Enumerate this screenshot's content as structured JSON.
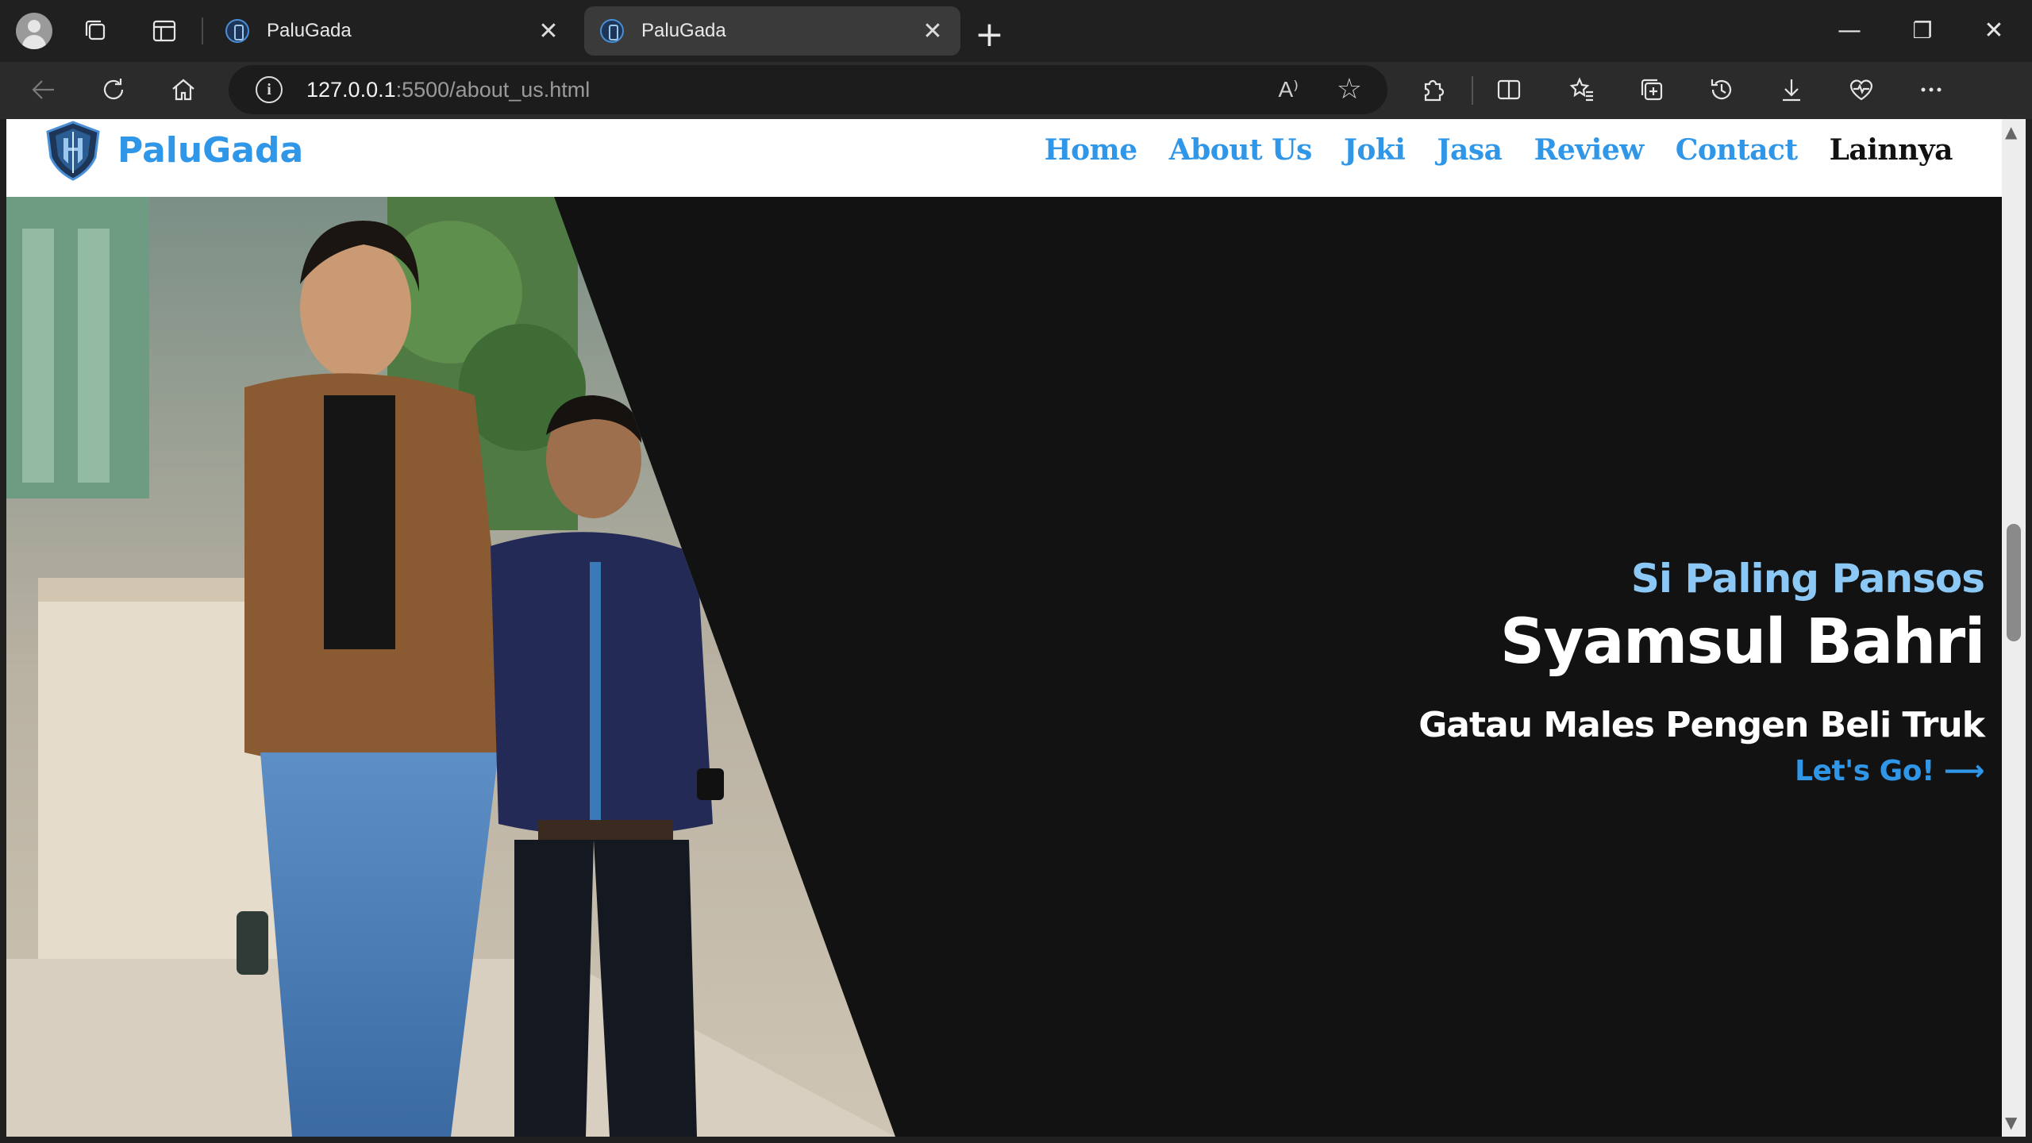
{
  "browser": {
    "tabs": [
      {
        "title": "PaluGada",
        "active": false
      },
      {
        "title": "PaluGada",
        "active": true
      }
    ],
    "url_host": "127.0.0.1",
    "url_rest": ":5500/about_us.html",
    "window_controls": {
      "minimize": "—",
      "restore": "❐",
      "close": "✕"
    },
    "tab_close_glyph": "✕",
    "new_tab_glyph": "+",
    "read_aloud_glyph": "A⁾",
    "info_glyph": "i",
    "star_glyph": "☆"
  },
  "site": {
    "brand": "PaluGada",
    "nav": [
      {
        "label": "Home",
        "active": true
      },
      {
        "label": "About Us",
        "active": true
      },
      {
        "label": "Joki",
        "active": true
      },
      {
        "label": "Jasa",
        "active": true
      },
      {
        "label": "Review",
        "active": true
      },
      {
        "label": "Contact",
        "active": true
      },
      {
        "label": "Lainnya",
        "active": false
      }
    ]
  },
  "hero": {
    "subtitle": "Si Paling Pansos",
    "name": "Syamsul Bahri",
    "tagline": "Gatau Males Pengen Beli Truk",
    "cta": "Let's Go! ⟶"
  },
  "colors": {
    "brand_blue": "#2f96e8",
    "subtitle_blue": "#8cc8f5",
    "hero_bg": "#121212",
    "chrome_bg": "#202020"
  },
  "scrollbar": {
    "up": "▲",
    "down": "▼"
  }
}
